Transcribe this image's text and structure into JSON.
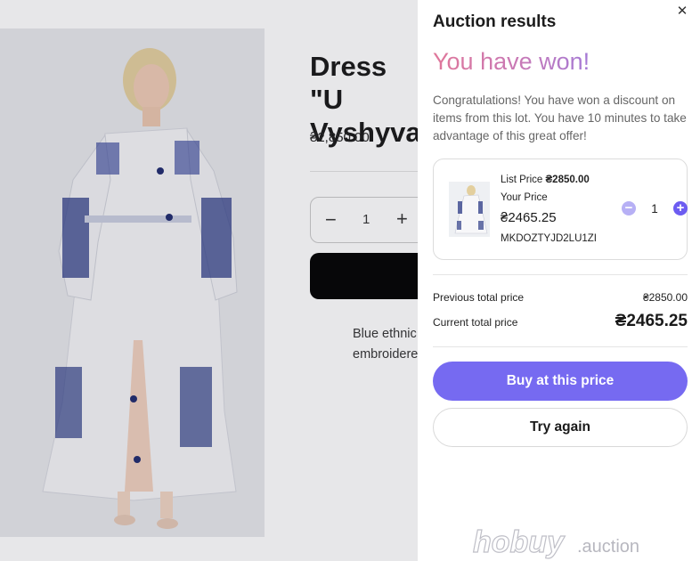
{
  "product": {
    "title": "Dress \"U\nVyshyva",
    "price": "₴2,850.00",
    "qty_minus": "−",
    "qty_value": "1",
    "qty_plus": "+",
    "description": "Blue ethnic\nembroidere"
  },
  "drawer": {
    "title": "Auction results",
    "close_icon": "close-icon",
    "headline": "You have won!",
    "message": "Congratulations! You have won a discount on items from this lot. You have 10 minutes to take advantage of this great offer!",
    "lot": {
      "list_price_label": "List Price",
      "list_price_value": "₴2850.00",
      "your_price_label": "Your Price",
      "your_price_value": "₴2465.25",
      "sku": "MKDOZTYJD2LU1ZI",
      "quantity": "1",
      "minus": "−",
      "plus": "+"
    },
    "totals": {
      "previous_label": "Previous total price",
      "previous_value": "₴2850.00",
      "current_label": "Current total price",
      "current_value": "₴2465.25"
    },
    "buttons": {
      "buy": "Buy at this price",
      "try_again": "Try again"
    }
  },
  "watermark": {
    "brand": "hobuy",
    "suffix": ".auction"
  },
  "colors": {
    "accent": "#766af1",
    "headline_gradient_start": "#e0779a",
    "headline_gradient_end": "#a57ad6",
    "stepper_minus": "#b7b0f5",
    "stepper_plus": "#6c5cf1"
  }
}
